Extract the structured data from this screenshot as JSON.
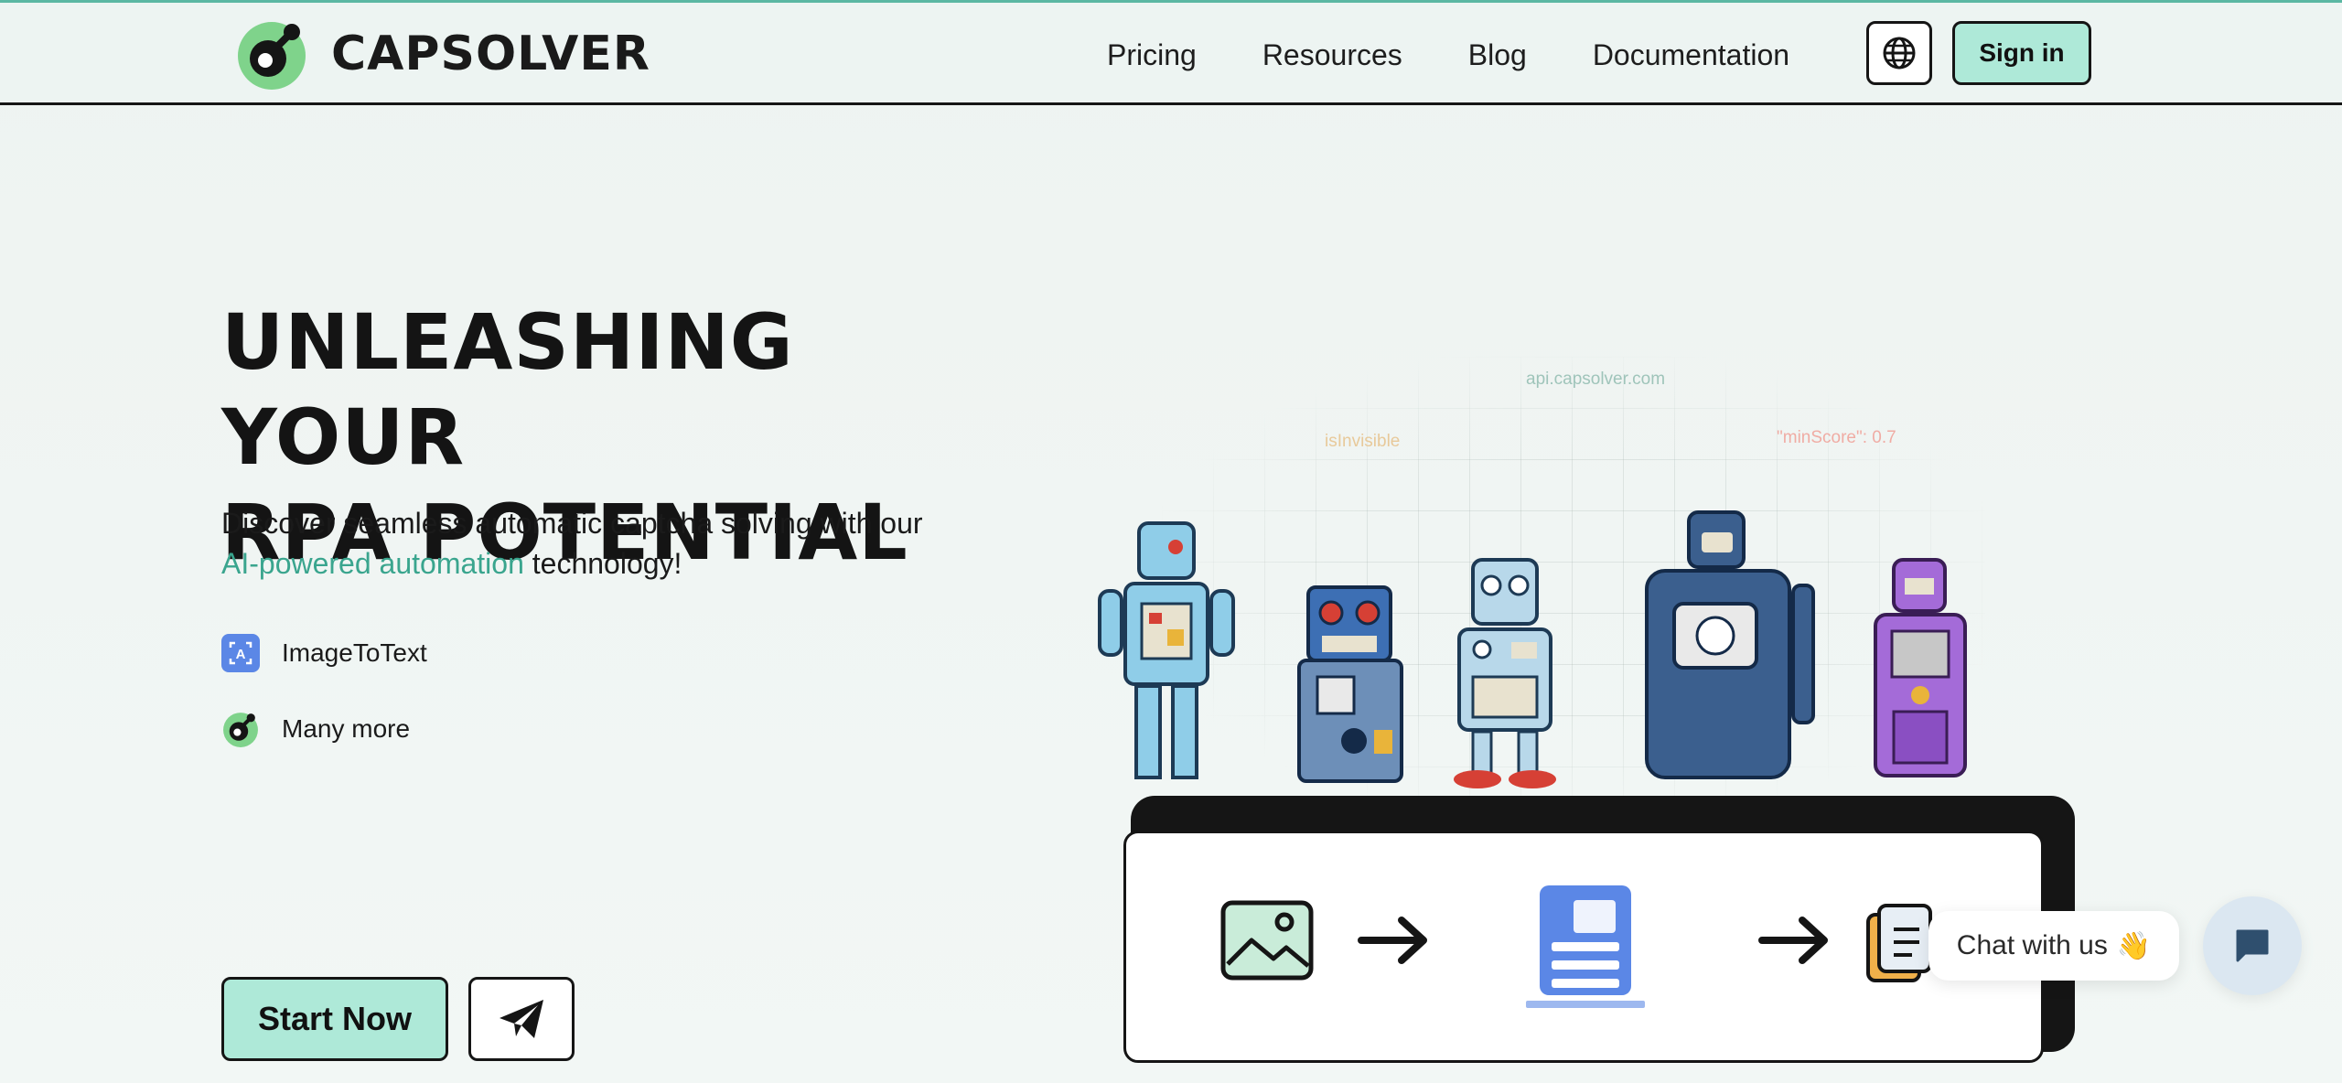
{
  "header": {
    "brand": "CAPSOLVER",
    "nav": [
      "Pricing",
      "Resources",
      "Blog",
      "Documentation"
    ],
    "sign_in": "Sign in"
  },
  "hero": {
    "title_line1": "UNLEASHING YOUR",
    "title_line2": "RPA POTENTIAL",
    "desc_part1": "Discover seamless automatic captcha solving with our",
    "desc_accent": "AI-powered automation",
    "desc_part2": " technology!",
    "features": [
      {
        "label": "ImageToText",
        "icon": "image-to-text-icon"
      },
      {
        "label": "Many more",
        "icon": "capsolver-logo-icon"
      }
    ],
    "start_button": "Start Now"
  },
  "illustration": {
    "labels": [
      "api.capsolver.com",
      "isInvisible",
      "\"minScore\": 0.7"
    ]
  },
  "chat": {
    "bubble_text": "Chat with us",
    "emoji": "👋"
  },
  "colors": {
    "accent": "#3aa58e",
    "button_mint": "#aee9d8",
    "doc_blue": "#5b87e6",
    "logo_green": "#7fd38b"
  }
}
